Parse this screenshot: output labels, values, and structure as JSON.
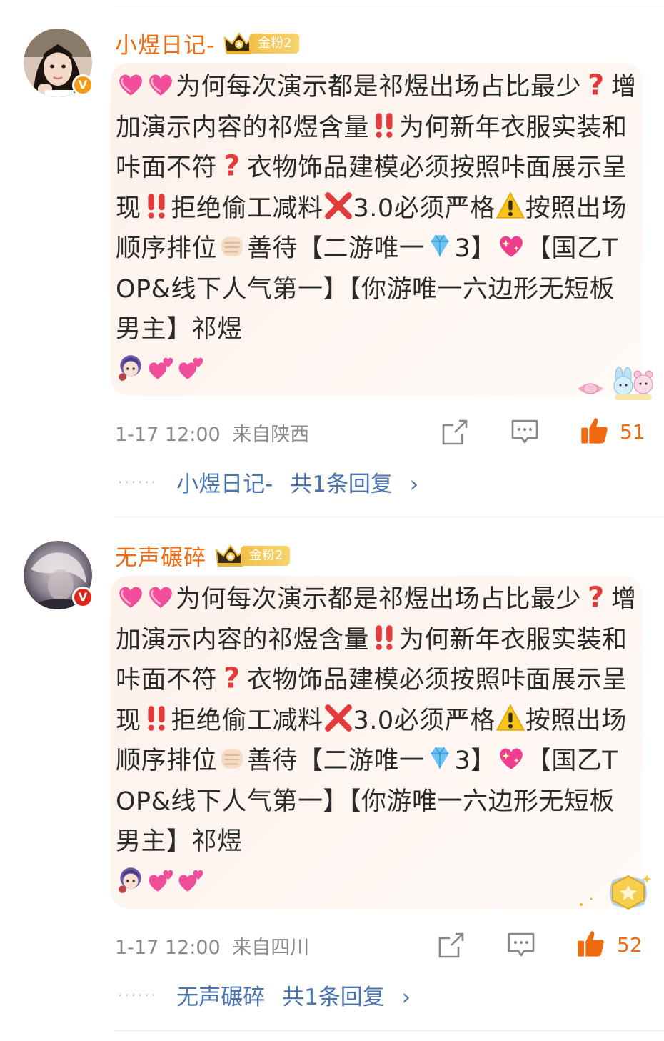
{
  "comments": [
    {
      "username": "小煜日记-",
      "fan_level": "金粉2",
      "text_parts": {
        "p1": "为何每次演示都是祁煜出场占比最少",
        "p2": "增加演示内容的祁煜含量",
        "p3": "为何新年衣服实装和咔面不符",
        "p4": "衣物饰品建模必须按照咔面展示呈现",
        "p5": "拒绝偷工减料",
        "p6": "3.0必须严格",
        "p7": "按照出场顺序排位",
        "p8": "善待【二游唯一",
        "p9": "3】",
        "p10": "【国乙TOP&线下人气第一】【你游唯一六边形无短板男主】祁煜"
      },
      "timestamp": "1-17 12:00",
      "location": "来自陕西",
      "likes": "51",
      "reply_user": "小煜日记-",
      "reply_count_text": "共1条回复",
      "reply_chevron": "›",
      "dots": "······",
      "verified_badge": "V",
      "badge_color": "#f59a12",
      "sticker": "bunny-bear-candy-sticker"
    },
    {
      "username": "无声碾碎",
      "fan_level": "金粉2",
      "text_parts": {
        "p1": "为何每次演示都是祁煜出场占比最少",
        "p2": "增加演示内容的祁煜含量",
        "p3": "为何新年衣服实装和咔面不符",
        "p4": "衣物饰品建模必须按照咔面展示呈现",
        "p5": "拒绝偷工减料",
        "p6": "3.0必须严格",
        "p7": "按照出场顺序排位",
        "p8": "善待【二游唯一",
        "p9": "3】",
        "p10": "【国乙TOP&线下人气第一】【你游唯一六边形无短板男主】祁煜"
      },
      "timestamp": "1-17 12:00",
      "location": "来自四川",
      "likes": "52",
      "reply_user": "无声碾碎",
      "reply_count_text": "共1条回复",
      "reply_chevron": "›",
      "dots": "······",
      "verified_badge": "V",
      "badge_color": "#e0261a",
      "sticker": "gold-star-badge-sticker"
    }
  ],
  "colors": {
    "username": "#f06a0f",
    "link": "#4a74ad",
    "meta": "#8a8a8a",
    "like_accent": "#f06a0f",
    "bubble": "#fdf1ea"
  }
}
